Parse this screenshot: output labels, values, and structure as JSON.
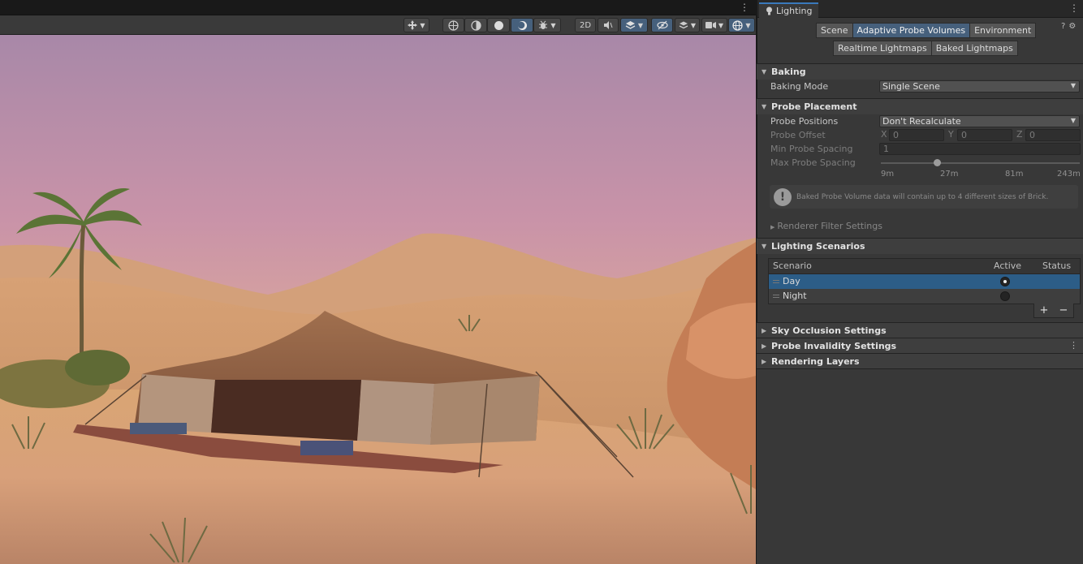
{
  "scene": {
    "toolbar": {
      "mode_2d": "2D"
    }
  },
  "panel": {
    "tab_title": "Lighting",
    "top_tabs": [
      "Scene",
      "Adaptive Probe Volumes",
      "Environment"
    ],
    "sub_tabs": [
      "Realtime Lightmaps",
      "Baked Lightmaps"
    ],
    "active_top_tab": "Adaptive Probe Volumes",
    "baking": {
      "title": "Baking",
      "mode_label": "Baking Mode",
      "mode_value": "Single Scene"
    },
    "probe_placement": {
      "title": "Probe Placement",
      "positions_label": "Probe Positions",
      "positions_value": "Don't Recalculate",
      "offset_label": "Probe Offset",
      "offset_axes": [
        "X",
        "Y",
        "Z"
      ],
      "offset_values": [
        "0",
        "0",
        "0"
      ],
      "min_spacing_label": "Min Probe Spacing",
      "min_spacing_value": "1",
      "max_spacing_label": "Max Probe Spacing",
      "max_spacing_ticks": [
        "9m",
        "27m",
        "81m",
        "243m"
      ],
      "slider_position": 0.28,
      "info_text": "Baked Probe Volume data will contain up to 4 different sizes of Brick.",
      "renderer_filter": "Renderer Filter Settings"
    },
    "lighting_scenarios": {
      "title": "Lighting Scenarios",
      "columns": [
        "Scenario",
        "Active",
        "Status"
      ],
      "rows": [
        {
          "name": "Day",
          "active": true
        },
        {
          "name": "Night",
          "active": false
        }
      ],
      "add": "+",
      "remove": "−"
    },
    "collapsed_sections": [
      "Sky Occlusion Settings",
      "Probe Invalidity Settings",
      "Rendering Layers"
    ]
  }
}
